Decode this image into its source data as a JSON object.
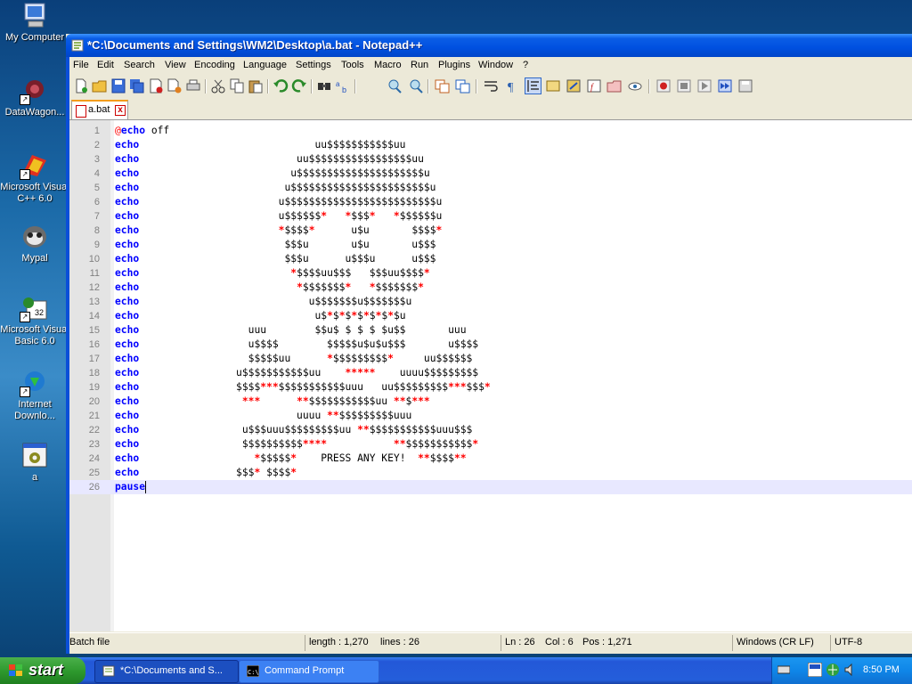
{
  "desktop": {
    "icons": [
      {
        "label": "My Computer",
        "icon": "computer-icon"
      },
      {
        "label": "DataWagon...",
        "icon": "datawagon-icon"
      },
      {
        "label": "Microsoft Visual C++ 6.0",
        "icon": "visual-cpp-icon"
      },
      {
        "label": "Mypal",
        "icon": "mypal-icon"
      },
      {
        "label": "Microsoft Visual Basic 6.0",
        "icon": "visual-basic-icon"
      },
      {
        "label": "Internet Downlo...",
        "icon": "internet-download-icon"
      },
      {
        "label": "a",
        "icon": "batch-file-icon"
      }
    ]
  },
  "window": {
    "title": "*C:\\Documents and Settings\\WM2\\Desktop\\a.bat - Notepad++",
    "menu": [
      "File",
      "Edit",
      "Search",
      "View",
      "Encoding",
      "Language",
      "Settings",
      "Tools",
      "Macro",
      "Run",
      "Plugins",
      "Window",
      "?"
    ],
    "tab": {
      "label": "a.bat",
      "close": "x"
    },
    "lines": [
      {
        "n": "1",
        "t": [
          [
            "at",
            "@"
          ],
          [
            "kw",
            "echo"
          ],
          [
            "pl",
            " off"
          ]
        ]
      },
      {
        "n": "2",
        "t": [
          [
            "kw",
            "echo"
          ],
          [
            "pl",
            "                             uu$$$$$$$$$$$uu"
          ]
        ]
      },
      {
        "n": "3",
        "t": [
          [
            "kw",
            "echo"
          ],
          [
            "pl",
            "                          uu$$$$$$$$$$$$$$$$$uu"
          ]
        ]
      },
      {
        "n": "4",
        "t": [
          [
            "kw",
            "echo"
          ],
          [
            "pl",
            "                         u$$$$$$$$$$$$$$$$$$$$$u"
          ]
        ]
      },
      {
        "n": "5",
        "t": [
          [
            "kw",
            "echo"
          ],
          [
            "pl",
            "                        u$$$$$$$$$$$$$$$$$$$$$$$u"
          ]
        ]
      },
      {
        "n": "6",
        "t": [
          [
            "kw",
            "echo"
          ],
          [
            "pl",
            "                       u$$$$$$$$$$$$$$$$$$$$$$$$$u"
          ]
        ]
      },
      {
        "n": "7",
        "t": [
          [
            "kw",
            "echo"
          ],
          [
            "pl",
            "                       u$$$$$$"
          ],
          [
            "st",
            "*"
          ],
          [
            "pl",
            "   "
          ],
          [
            "st",
            "*"
          ],
          [
            "pl",
            "$$$"
          ],
          [
            "st",
            "*"
          ],
          [
            "pl",
            "   "
          ],
          [
            "st",
            "*"
          ],
          [
            "pl",
            "$$$$$$u"
          ]
        ]
      },
      {
        "n": "8",
        "t": [
          [
            "kw",
            "echo"
          ],
          [
            "pl",
            "                       "
          ],
          [
            "st",
            "*"
          ],
          [
            "pl",
            "$$$$"
          ],
          [
            "st",
            "*"
          ],
          [
            "pl",
            "      u$u       $$$$"
          ],
          [
            "st",
            "*"
          ]
        ]
      },
      {
        "n": "9",
        "t": [
          [
            "kw",
            "echo"
          ],
          [
            "pl",
            "                        $$$u       u$u       u$$$"
          ]
        ]
      },
      {
        "n": "10",
        "t": [
          [
            "kw",
            "echo"
          ],
          [
            "pl",
            "                        $$$u      u$$$u      u$$$"
          ]
        ]
      },
      {
        "n": "11",
        "t": [
          [
            "kw",
            "echo"
          ],
          [
            "pl",
            "                         "
          ],
          [
            "st",
            "*"
          ],
          [
            "pl",
            "$$$$uu$$$   $$$uu$$$$"
          ],
          [
            "st",
            "*"
          ]
        ]
      },
      {
        "n": "12",
        "t": [
          [
            "kw",
            "echo"
          ],
          [
            "pl",
            "                          "
          ],
          [
            "st",
            "*"
          ],
          [
            "pl",
            "$$$$$$$"
          ],
          [
            "st",
            "*"
          ],
          [
            "pl",
            "   "
          ],
          [
            "st",
            "*"
          ],
          [
            "pl",
            "$$$$$$$"
          ],
          [
            "st",
            "*"
          ]
        ]
      },
      {
        "n": "13",
        "t": [
          [
            "kw",
            "echo"
          ],
          [
            "pl",
            "                            u$$$$$$$u$$$$$$$u"
          ]
        ]
      },
      {
        "n": "14",
        "t": [
          [
            "kw",
            "echo"
          ],
          [
            "pl",
            "                             u$"
          ],
          [
            "st",
            "*"
          ],
          [
            "pl",
            "$"
          ],
          [
            "st",
            "*"
          ],
          [
            "pl",
            "$"
          ],
          [
            "st",
            "*"
          ],
          [
            "pl",
            "$"
          ],
          [
            "st",
            "*"
          ],
          [
            "pl",
            "$"
          ],
          [
            "st",
            "*"
          ],
          [
            "pl",
            "$"
          ],
          [
            "st",
            "*"
          ],
          [
            "pl",
            "$u"
          ]
        ]
      },
      {
        "n": "15",
        "t": [
          [
            "kw",
            "echo"
          ],
          [
            "pl",
            "                  uuu        $$u$ $ $ $ $u$$       uuu"
          ]
        ]
      },
      {
        "n": "16",
        "t": [
          [
            "kw",
            "echo"
          ],
          [
            "pl",
            "                  u$$$$        $$$$$u$u$u$$$       u$$$$"
          ]
        ]
      },
      {
        "n": "17",
        "t": [
          [
            "kw",
            "echo"
          ],
          [
            "pl",
            "                  $$$$$uu      "
          ],
          [
            "st",
            "*"
          ],
          [
            "pl",
            "$$$$$$$$$"
          ],
          [
            "st",
            "*"
          ],
          [
            "pl",
            "     uu$$$$$$"
          ]
        ]
      },
      {
        "n": "18",
        "t": [
          [
            "kw",
            "echo"
          ],
          [
            "pl",
            "                u$$$$$$$$$$$uu    "
          ],
          [
            "st",
            "*****"
          ],
          [
            "pl",
            "    uuuu$$$$$$$$$"
          ]
        ]
      },
      {
        "n": "19",
        "t": [
          [
            "kw",
            "echo"
          ],
          [
            "pl",
            "                $$$$"
          ],
          [
            "st",
            "***"
          ],
          [
            "pl",
            "$$$$$$$$$$$uuu   uu$$$$$$$$$"
          ],
          [
            "st",
            "***"
          ],
          [
            "pl",
            "$$$"
          ],
          [
            "st",
            "*"
          ]
        ]
      },
      {
        "n": "20",
        "t": [
          [
            "kw",
            "echo"
          ],
          [
            "pl",
            "                 "
          ],
          [
            "st",
            "***"
          ],
          [
            "pl",
            "      "
          ],
          [
            "st",
            "**"
          ],
          [
            "pl",
            "$$$$$$$$$$$uu "
          ],
          [
            "st",
            "**"
          ],
          [
            "pl",
            "$"
          ],
          [
            "st",
            "***"
          ]
        ]
      },
      {
        "n": "21",
        "t": [
          [
            "kw",
            "echo"
          ],
          [
            "pl",
            "                          uuuu "
          ],
          [
            "st",
            "**"
          ],
          [
            "pl",
            "$$$$$$$$$uuu"
          ]
        ]
      },
      {
        "n": "22",
        "t": [
          [
            "kw",
            "echo"
          ],
          [
            "pl",
            "                 u$$$uuu$$$$$$$$$uu "
          ],
          [
            "st",
            "**"
          ],
          [
            "pl",
            "$$$$$$$$$$$uuu$$$"
          ]
        ]
      },
      {
        "n": "23",
        "t": [
          [
            "kw",
            "echo"
          ],
          [
            "pl",
            "                 $$$$$$$$$$"
          ],
          [
            "st",
            "****"
          ],
          [
            "pl",
            "           "
          ],
          [
            "st",
            "**"
          ],
          [
            "pl",
            "$$$$$$$$$$$"
          ],
          [
            "st",
            "*"
          ]
        ]
      },
      {
        "n": "24",
        "t": [
          [
            "kw",
            "echo"
          ],
          [
            "pl",
            "                   "
          ],
          [
            "st",
            "*"
          ],
          [
            "pl",
            "$$$$$"
          ],
          [
            "st",
            "*"
          ],
          [
            "pl",
            "    PRESS ANY KEY!  "
          ],
          [
            "st",
            "**"
          ],
          [
            "pl",
            "$$$$"
          ],
          [
            "st",
            "**"
          ]
        ]
      },
      {
        "n": "25",
        "t": [
          [
            "kw",
            "echo"
          ],
          [
            "pl",
            "                $$$"
          ],
          [
            "st",
            "*"
          ],
          [
            "pl",
            " $$$$"
          ],
          [
            "st",
            "*"
          ]
        ]
      },
      {
        "n": "26",
        "t": [
          [
            "kw",
            "pause"
          ]
        ],
        "current": true
      }
    ],
    "status": {
      "type": "Batch file",
      "length": "length : 1,270",
      "lines": "lines : 26",
      "ln": "Ln : 26",
      "col": "Col : 6",
      "pos": "Pos : 1,271",
      "eol": "Windows (CR LF)",
      "encoding": "UTF-8"
    }
  },
  "taskbar": {
    "start": "start",
    "tasks": [
      {
        "label": "*C:\\Documents and S...",
        "icon": "notepadpp-icon"
      },
      {
        "label": "Command Prompt",
        "icon": "cmd-icon"
      }
    ],
    "clock": "8:50 PM"
  }
}
